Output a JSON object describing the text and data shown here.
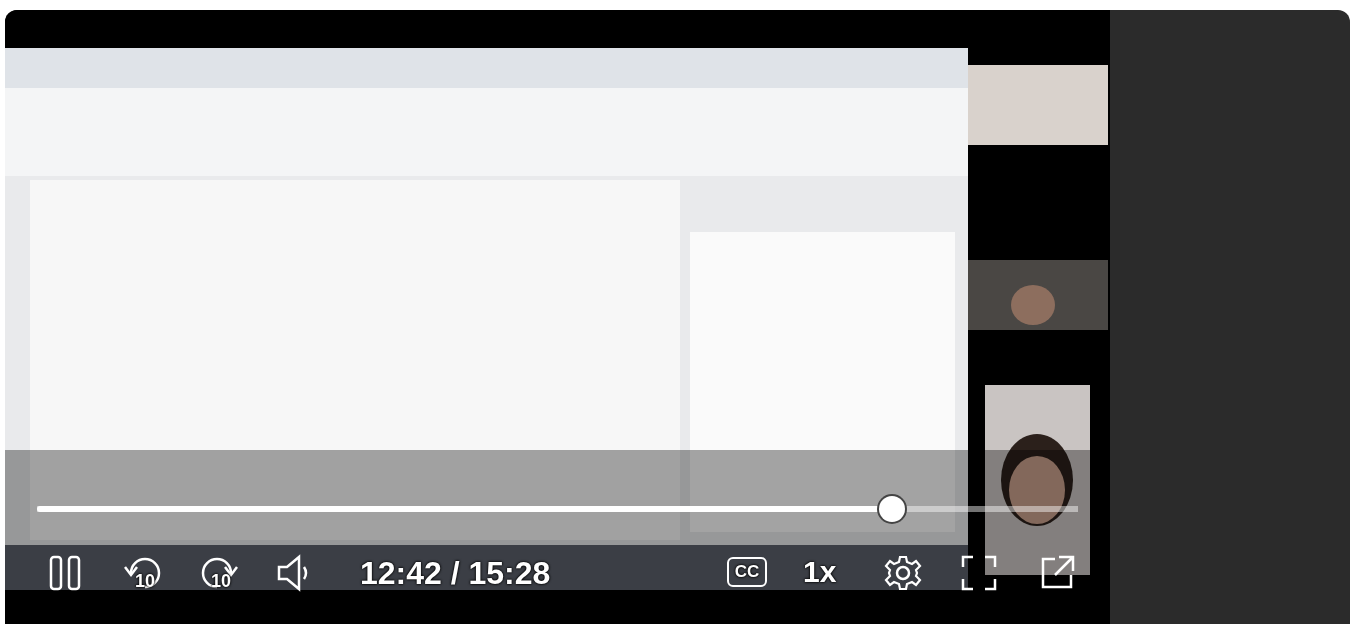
{
  "player": {
    "progress": {
      "level": 0.821
    },
    "skip_back": "10",
    "skip_forward": "10",
    "time": "12:42 / 15:28",
    "captions": "CC",
    "speed": "1x"
  }
}
